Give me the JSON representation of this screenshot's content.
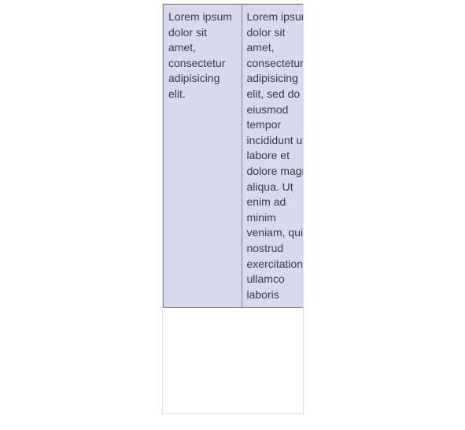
{
  "table": {
    "rows": [
      {
        "left": "Lorem ipsum dolor sit amet, consectetur adipisicing elit.",
        "right": "Lorem ipsum dolor sit amet, consectetur adipisicing elit, sed do eiusmod tempor incididunt ut labore et dolore magna aliqua. Ut enim ad minim veniam, quis nostrud exercitation ullamco laboris"
      }
    ]
  }
}
